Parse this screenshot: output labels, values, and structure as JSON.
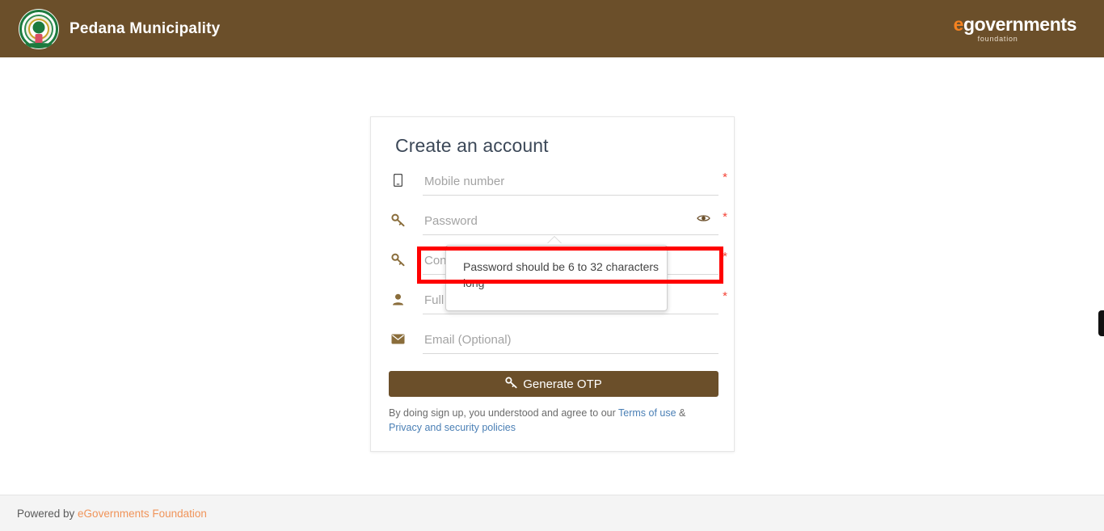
{
  "header": {
    "emblem_icon": "government-emblem-icon",
    "title": "Pedana Municipality",
    "brand": {
      "prefix": "e",
      "main": "governments",
      "sub": "foundation"
    }
  },
  "card": {
    "title": "Create an account",
    "fields": [
      {
        "name": "mobile",
        "icon": "mobile-phone-icon",
        "placeholder": "Mobile number",
        "value": "",
        "required_marker": "*"
      },
      {
        "name": "password",
        "icon": "key-icon",
        "placeholder": "Password",
        "value": "",
        "required_marker": "*",
        "toggle_icon": "eye-icon"
      },
      {
        "name": "confirm-password",
        "icon": "key-icon",
        "placeholder": "Confirm password",
        "value": "",
        "required_marker": "*"
      },
      {
        "name": "fullname",
        "icon": "user-icon",
        "placeholder": "Full name",
        "value": "",
        "required_marker": "*"
      },
      {
        "name": "email",
        "icon": "envelope-icon",
        "placeholder": "Email (Optional)",
        "value": "",
        "required_marker": ""
      }
    ],
    "tooltip": {
      "message": "Password should be 6 to 32 characters long"
    },
    "submit": {
      "icon": "key-icon",
      "label": "Generate OTP"
    },
    "terms": {
      "lead": "By doing sign up, you understood and agree to our ",
      "link1": "Terms of use",
      "separator": " & ",
      "link2": "Privacy and security policies"
    }
  },
  "footer": {
    "lead": "Powered by ",
    "link": "eGovernments Foundation"
  },
  "colors": {
    "header_brown": "#6b4f2a",
    "accent_orange": "#f58220",
    "validation_red": "#ff0000",
    "required_red": "#f44336",
    "link_blue": "#4a7fb5",
    "footer_link_orange": "#f0945a"
  }
}
